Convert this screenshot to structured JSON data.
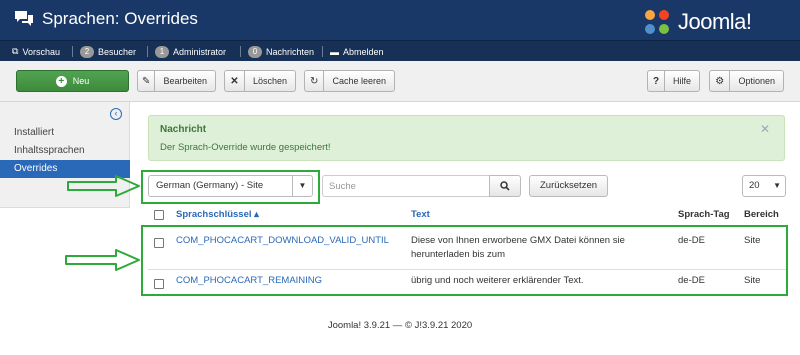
{
  "header": {
    "title": "Sprachen: Overrides",
    "logo_text": "Joomla!"
  },
  "statusbar": {
    "preview": "Vorschau",
    "visitors_count": "2",
    "visitors_label": "Besucher",
    "admins_count": "1",
    "admins_label": "Administrator",
    "messages_count": "0",
    "messages_label": "Nachrichten",
    "logout": "Abmelden"
  },
  "toolbar": {
    "new": "Neu",
    "edit": "Bearbeiten",
    "delete": "Löschen",
    "clear_cache": "Cache leeren",
    "help": "Hilfe",
    "options": "Optionen"
  },
  "sidebar": {
    "items": [
      "Installiert",
      "Inhaltssprachen",
      "Overrides"
    ],
    "active_index": 2
  },
  "alert": {
    "heading": "Nachricht",
    "message": "Der Sprach-Override wurde gespeichert!"
  },
  "filters": {
    "language": "German (Germany) - Site",
    "search_placeholder": "Suche",
    "reset": "Zurücksetzen",
    "limit": "20"
  },
  "table": {
    "columns": {
      "key": "Sprachschlüssel",
      "text": "Text",
      "tag": "Sprach-Tag",
      "area": "Bereich"
    },
    "rows": [
      {
        "key": "COM_PHOCACART_DOWNLOAD_VALID_UNTIL",
        "text_line1": "Diese von Ihnen erworbene GMX Datei können sie",
        "text_line2": "herunterladen bis zum",
        "tag": "de-DE",
        "area": "Site"
      },
      {
        "key": "COM_PHOCACART_REMAINING",
        "text_line1": "übrig und noch weiterer erklärender Text.",
        "text_line2": "",
        "tag": "de-DE",
        "area": "Site"
      }
    ]
  },
  "footer": "Joomla! 3.9.21 — © J!3.9.21 2020",
  "colors": {
    "header": "#1a3867",
    "accent": "#2a69b8",
    "success": "#3d8b3d",
    "highlight": "#2eaa3a"
  }
}
